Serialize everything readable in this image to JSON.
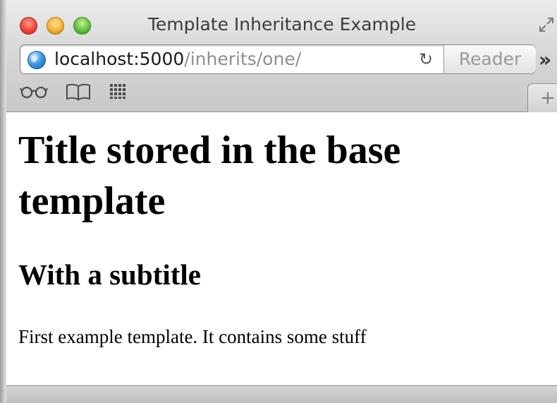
{
  "window": {
    "title": "Template Inheritance Example"
  },
  "toolbar": {
    "url_host": "localhost:5000",
    "url_path": "/inherits/one/",
    "reader_label": "Reader",
    "overflow_label": "»",
    "reload_label": "↻",
    "new_tab_label": "+"
  },
  "bookmarks_bar": {
    "icons": [
      "reading-list-icon",
      "bookmarks-book-icon",
      "top-sites-grid-icon"
    ]
  },
  "page": {
    "heading": "Title stored in the base template",
    "subtitle": "With a subtitle",
    "body_text": "First example template. It contains some stuff"
  },
  "colors": {
    "url_host": "#1a1a1a",
    "url_path": "#8e8e8e",
    "reader_text": "#9a9a9a"
  }
}
